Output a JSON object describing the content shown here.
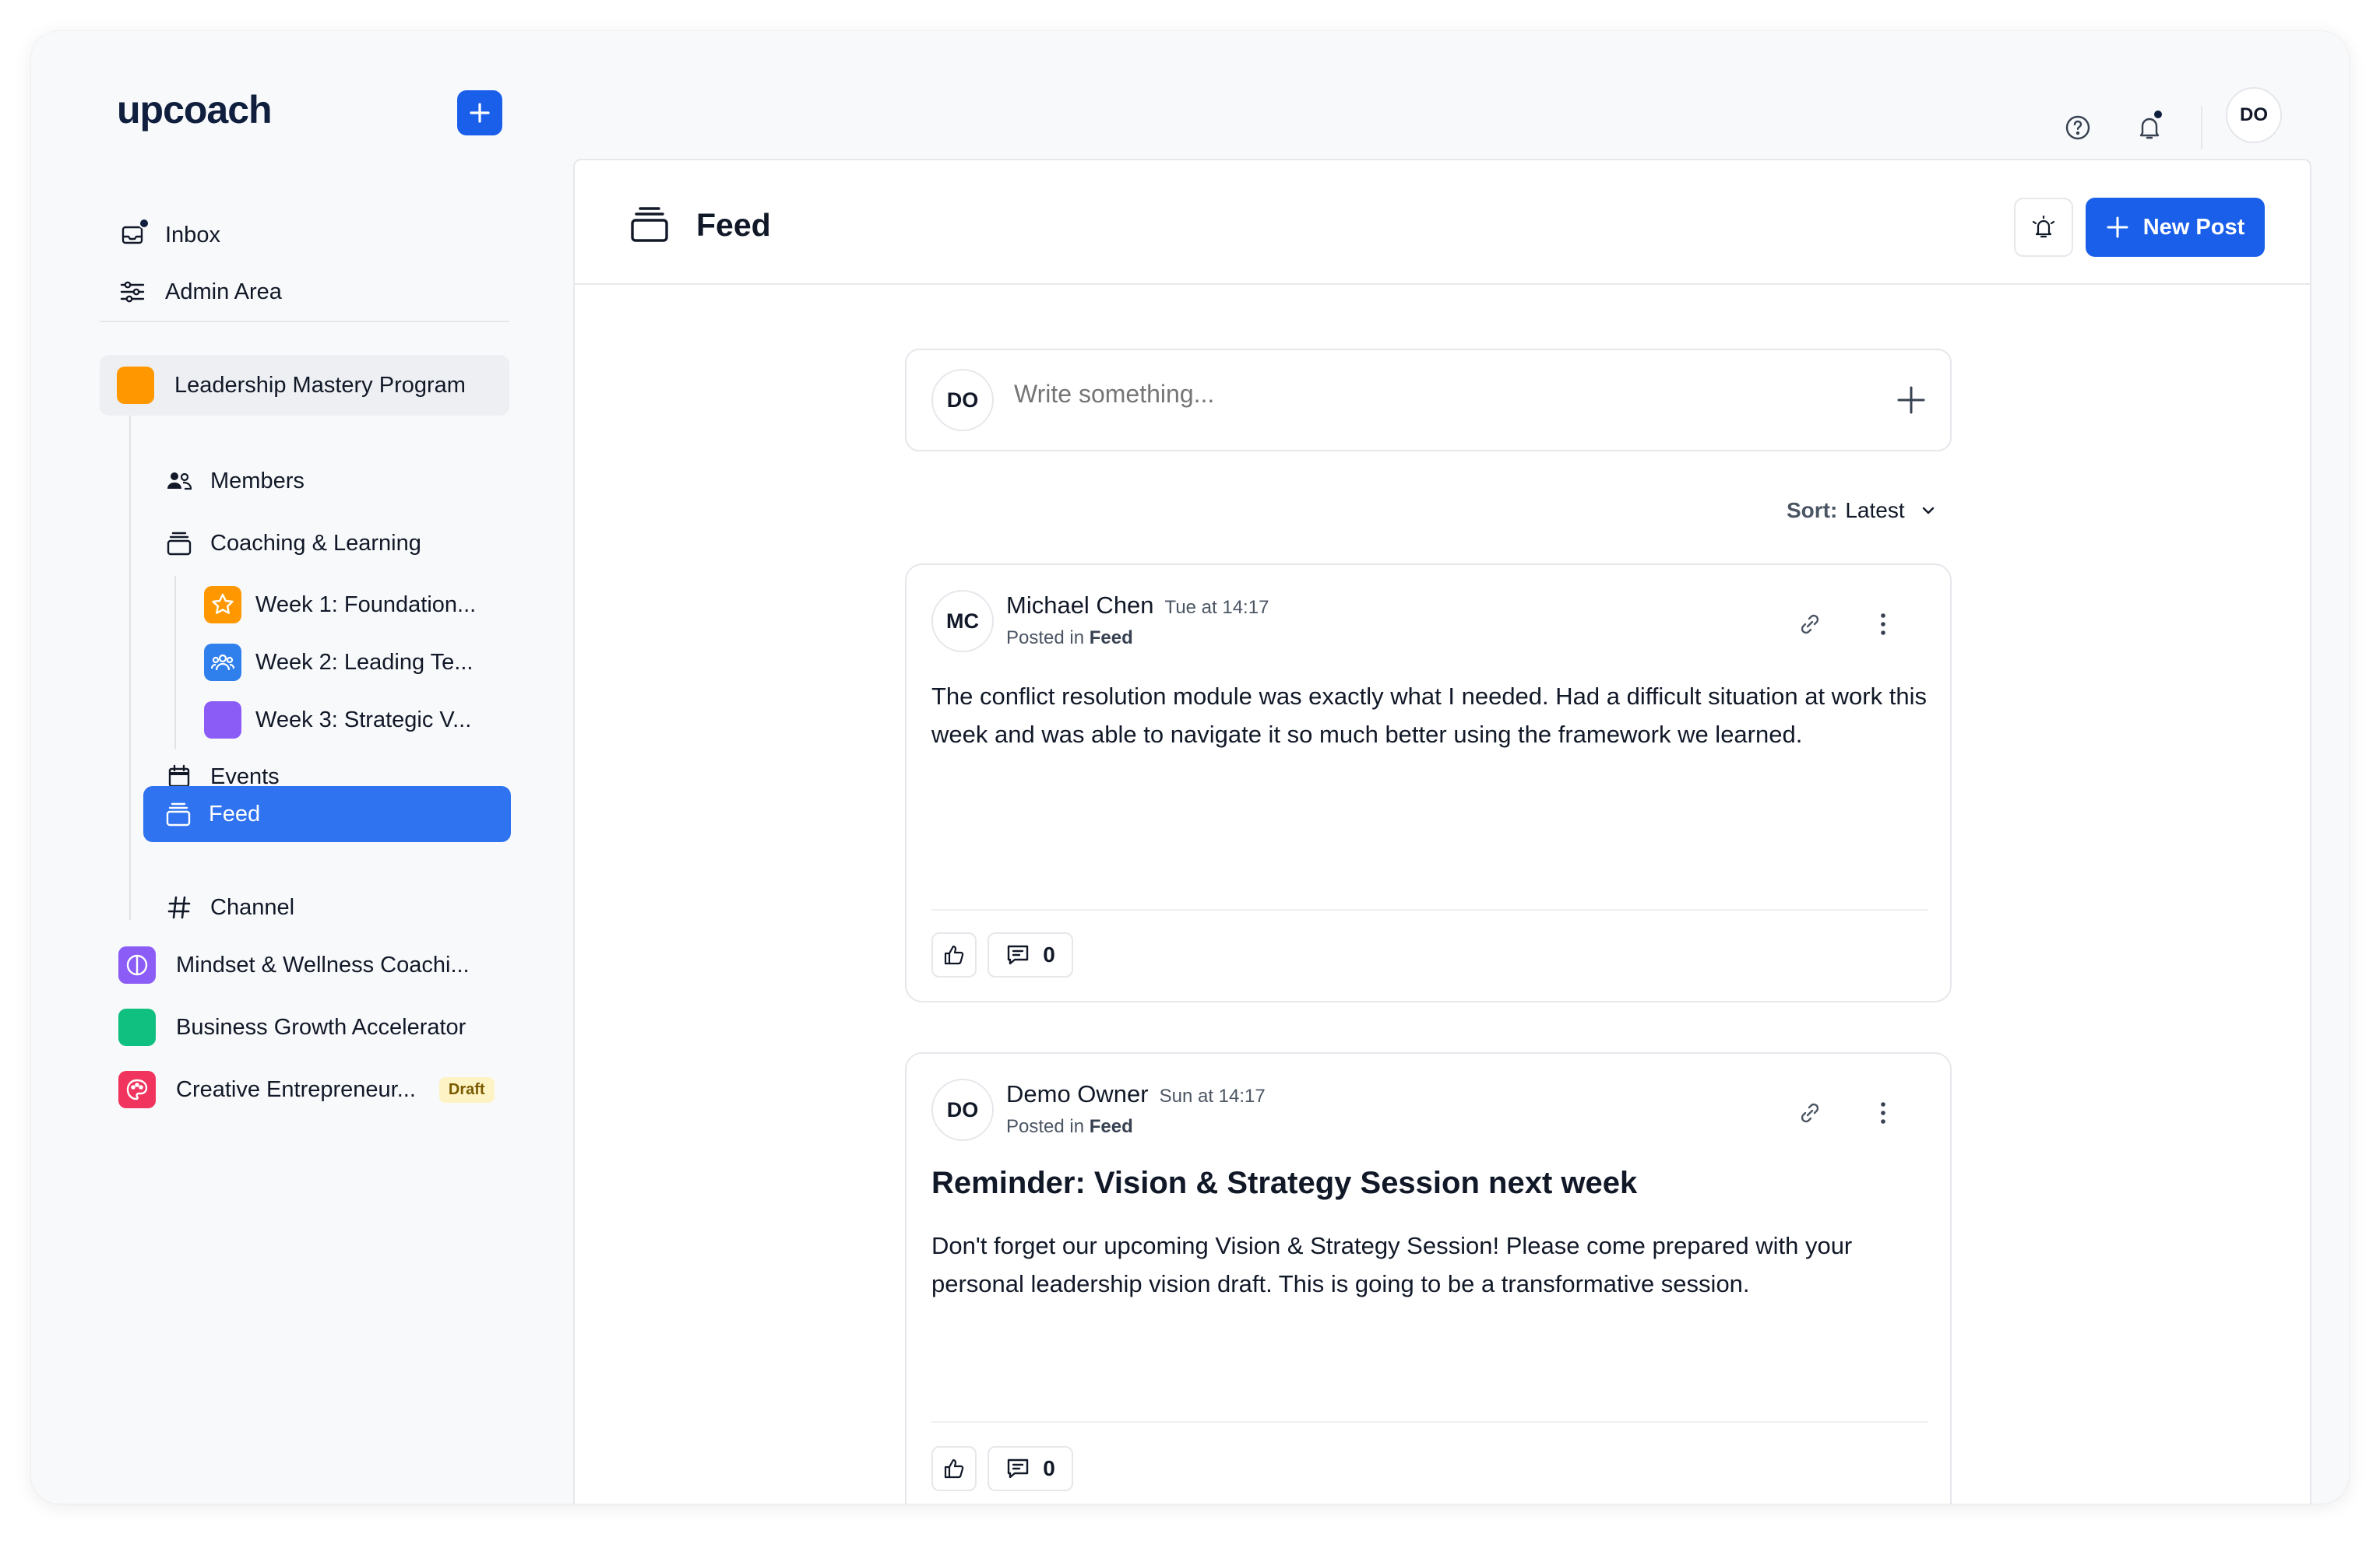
{
  "app": {
    "logo": "upcoach"
  },
  "topbar": {
    "avatar_initials": "DO"
  },
  "sidebar": {
    "nav": [
      {
        "label": "Inbox"
      },
      {
        "label": "Admin Area"
      }
    ],
    "program": {
      "label": "Leadership Mastery Program",
      "color": "#ff9800",
      "items": [
        {
          "label": "Members"
        },
        {
          "label": "Coaching & Learning"
        },
        {
          "label": "Events"
        },
        {
          "label": "Feed"
        },
        {
          "label": "Channel"
        }
      ],
      "weeks": [
        {
          "label": "Week 1: Foundation...",
          "color": "#ff9800"
        },
        {
          "label": "Week 2: Leading Te...",
          "color": "#2f80ed"
        },
        {
          "label": "Week 3: Strategic V...",
          "color": "#8b5cf6"
        }
      ]
    },
    "other_programs": [
      {
        "label": "Mindset & Wellness Coachi...",
        "color": "#8b5cf6"
      },
      {
        "label": "Business Growth Accelerator",
        "color": "#10c080"
      },
      {
        "label": "Creative Entrepreneur...",
        "color": "#f0345e",
        "badge": "Draft"
      }
    ]
  },
  "main": {
    "title": "Feed",
    "new_post_label": "New Post",
    "composer": {
      "avatar_initials": "DO",
      "placeholder": "Write something..."
    },
    "sort": {
      "key": "Sort:",
      "value": "Latest"
    },
    "posts": [
      {
        "initials": "MC",
        "author": "Michael Chen",
        "time": "Tue at 14:17",
        "posted_prefix": "Posted in",
        "posted_in": "Feed",
        "title": "",
        "body": "The conflict resolution module was exactly what I needed. Had a difficult situation at work this week and was able to navigate it so much better using the framework we learned.",
        "comments": "0"
      },
      {
        "initials": "DO",
        "author": "Demo Owner",
        "time": "Sun at 14:17",
        "posted_prefix": "Posted in",
        "posted_in": "Feed",
        "title": "Reminder: Vision & Strategy Session next week",
        "body": "Don't forget our upcoming Vision & Strategy Session! Please come prepared with your personal leadership vision draft. This is going to be a transformative session.",
        "comments": "0"
      }
    ]
  }
}
